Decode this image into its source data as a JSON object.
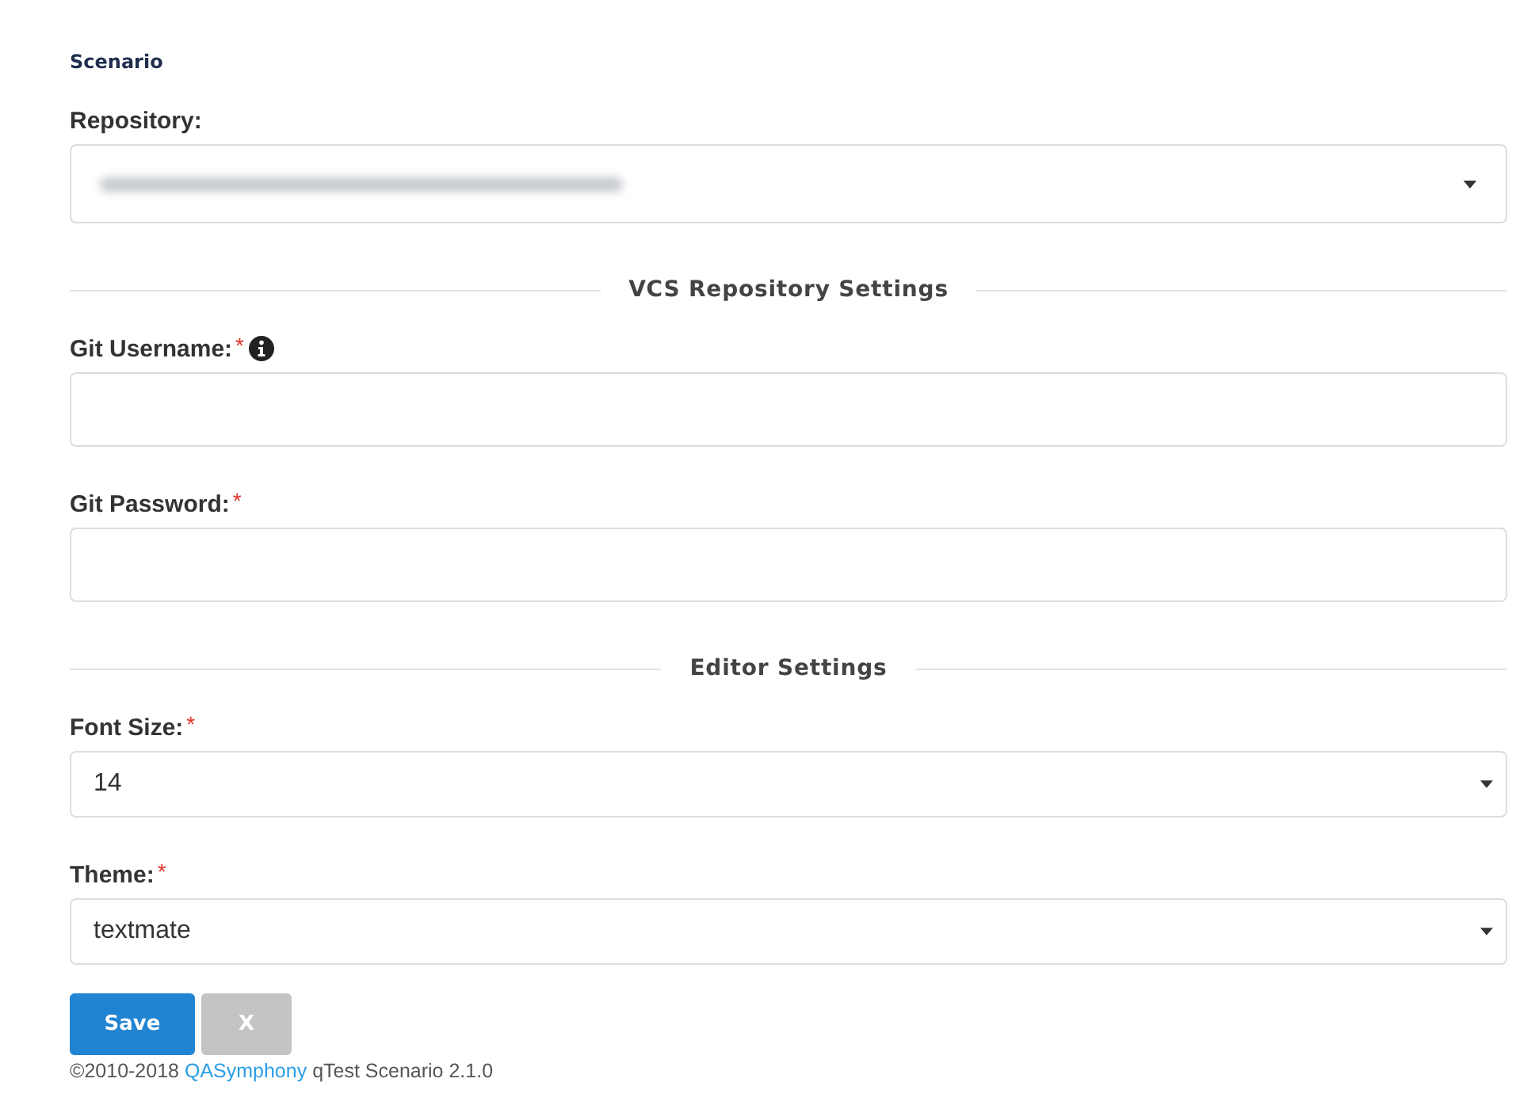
{
  "heading": "Scenario",
  "form_items": [
    {
      "kind": "repo_select",
      "label": "Repository:",
      "value_blurred": true
    },
    {
      "kind": "divider",
      "label": "VCS Repository Settings"
    },
    {
      "kind": "text",
      "label": "Git Username:",
      "required_mark": "*",
      "info": true
    },
    {
      "kind": "text",
      "label": "Git Password:",
      "required_mark": "*"
    },
    {
      "kind": "divider",
      "label": "Editor Settings"
    },
    {
      "kind": "select",
      "label": "Font Size:",
      "required_mark": "*",
      "value": "14"
    },
    {
      "kind": "select",
      "label": "Theme:",
      "required_mark": "*",
      "value": "textmate"
    }
  ],
  "buttons": [
    {
      "label": "Save",
      "kind": "primary"
    },
    {
      "label": "X",
      "kind": "secondary"
    }
  ],
  "footer": {
    "before": "©2010-2018 ",
    "link": "QASymphony",
    "after": " qTest Scenario 2.1.0"
  }
}
